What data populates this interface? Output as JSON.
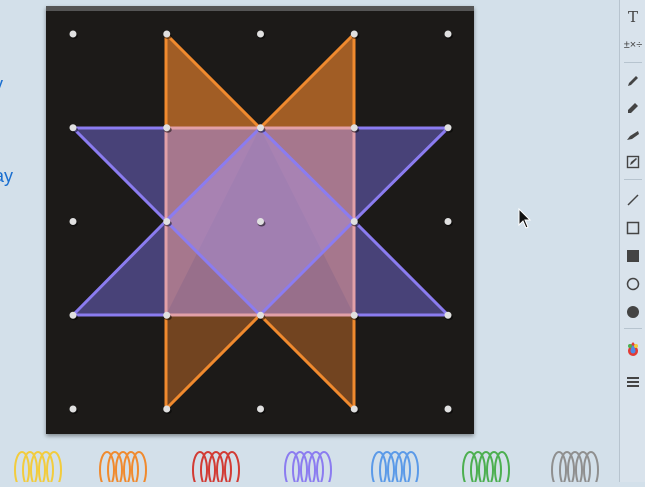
{
  "left_panel": {
    "text_line_1": "y",
    "text_line_2": "ay"
  },
  "toolbar": {
    "text_tool_label": "T",
    "operations_label": "±×÷",
    "icons": [
      "text-icon",
      "math-operations-icon",
      "pencil-icon",
      "marker-icon",
      "highlighter-icon",
      "edit-note-icon",
      "line-tool-icon",
      "rectangle-outline-icon",
      "rectangle-filled-icon",
      "circle-outline-icon",
      "circle-filled-icon",
      "color-palette-icon",
      "menu-icon"
    ]
  },
  "geoboard": {
    "grid_size": 5,
    "board_color": "#1c1a18",
    "peg_color": "#e0e0e0",
    "bands": [
      {
        "name": "orange-star",
        "color": "#f08a2e",
        "fill": "rgba(240,138,46,0.45)"
      },
      {
        "name": "purple-star",
        "color": "#8b7cf0",
        "fill": "rgba(130,110,240,0.42)"
      },
      {
        "name": "pink-square",
        "color": "#e2a0a8",
        "fill": "rgba(240,170,180,0.30)"
      },
      {
        "name": "purple-diamond",
        "color": "#8b7cf0",
        "fill": "rgba(160,140,230,0.45)"
      }
    ]
  },
  "band_tray": {
    "colors": [
      "#f2cc3d",
      "#f08a2e",
      "#d23b34",
      "#8b7cf0",
      "#5b9ae8",
      "#4caf50",
      "#8f8f8f"
    ]
  }
}
